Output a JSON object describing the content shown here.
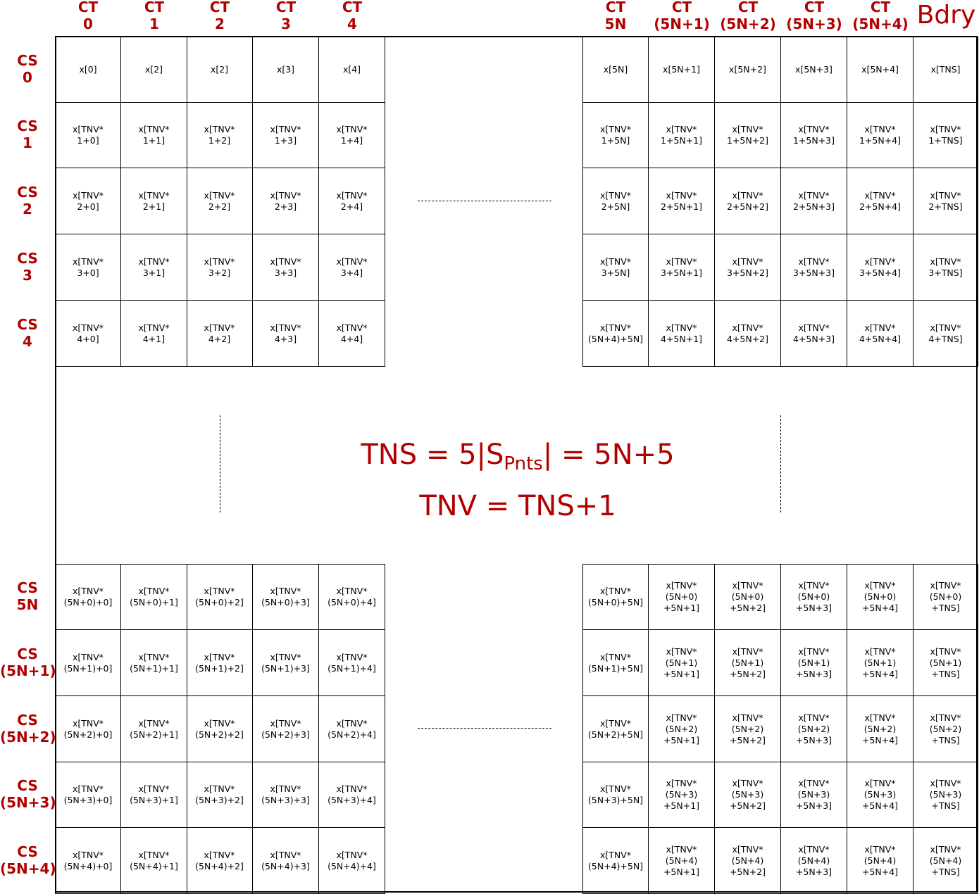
{
  "col_headers_left": [
    "CT\n0",
    "CT\n1",
    "CT\n2",
    "CT\n3",
    "CT\n4"
  ],
  "col_headers_right": [
    "CT\n5N",
    "CT\n(5N+1)",
    "CT\n(5N+2)",
    "CT\n(5N+3)",
    "CT\n(5N+4)"
  ],
  "bdry_label": "Bdry",
  "row_headers_top": [
    "CS\n0",
    "CS\n1",
    "CS\n2",
    "CS\n3",
    "CS\n4"
  ],
  "row_headers_bottom": [
    "CS\n5N",
    "CS\n(5N+1)",
    "CS\n(5N+2)",
    "CS\n(5N+3)",
    "CS\n(5N+4)"
  ],
  "blocks": {
    "top_left": [
      [
        "x[0]",
        "x[2]",
        "x[2]",
        "x[3]",
        "x[4]"
      ],
      [
        "x[TNV*\n1+0]",
        "x[TNV*\n1+1]",
        "x[TNV*\n1+2]",
        "x[TNV*\n1+3]",
        "x[TNV*\n1+4]"
      ],
      [
        "x[TNV*\n2+0]",
        "x[TNV*\n2+1]",
        "x[TNV*\n2+2]",
        "x[TNV*\n2+3]",
        "x[TNV*\n2+4]"
      ],
      [
        "x[TNV*\n3+0]",
        "x[TNV*\n3+1]",
        "x[TNV*\n3+2]",
        "x[TNV*\n3+3]",
        "x[TNV*\n3+4]"
      ],
      [
        "x[TNV*\n4+0]",
        "x[TNV*\n4+1]",
        "x[TNV*\n4+2]",
        "x[TNV*\n4+3]",
        "x[TNV*\n4+4]"
      ]
    ],
    "top_right": [
      [
        "x[5N]",
        "x[5N+1]",
        "x[5N+2]",
        "x[5N+3]",
        "x[5N+4]",
        "x[TNS]"
      ],
      [
        "x[TNV*\n1+5N]",
        "x[TNV*\n1+5N+1]",
        "x[TNV*\n1+5N+2]",
        "x[TNV*\n1+5N+3]",
        "x[TNV*\n1+5N+4]",
        "x[TNV*\n1+TNS]"
      ],
      [
        "x[TNV*\n2+5N]",
        "x[TNV*\n2+5N+1]",
        "x[TNV*\n2+5N+2]",
        "x[TNV*\n2+5N+3]",
        "x[TNV*\n2+5N+4]",
        "x[TNV*\n2+TNS]"
      ],
      [
        "x[TNV*\n3+5N]",
        "x[TNV*\n3+5N+1]",
        "x[TNV*\n3+5N+2]",
        "x[TNV*\n3+5N+3]",
        "x[TNV*\n3+5N+4]",
        "x[TNV*\n3+TNS]"
      ],
      [
        "x[TNV*\n(5N+4)+5N]",
        "x[TNV*\n4+5N+1]",
        "x[TNV*\n4+5N+2]",
        "x[TNV*\n4+5N+3]",
        "x[TNV*\n4+5N+4]",
        "x[TNV*\n4+TNS]"
      ]
    ],
    "bottom_left": [
      [
        "x[TNV*\n(5N+0)+0]",
        "x[TNV*\n(5N+0)+1]",
        "x[TNV*\n(5N+0)+2]",
        "x[TNV*\n(5N+0)+3]",
        "x[TNV*\n(5N+0)+4]"
      ],
      [
        "x[TNV*\n(5N+1)+0]",
        "x[TNV*\n(5N+1)+1]",
        "x[TNV*\n(5N+1)+2]",
        "x[TNV*\n(5N+1)+3]",
        "x[TNV*\n(5N+1)+4]"
      ],
      [
        "x[TNV*\n(5N+2)+0]",
        "x[TNV*\n(5N+2)+1]",
        "x[TNV*\n(5N+2)+2]",
        "x[TNV*\n(5N+2)+3]",
        "x[TNV*\n(5N+2)+4]"
      ],
      [
        "x[TNV*\n(5N+3)+0]",
        "x[TNV*\n(5N+3)+1]",
        "x[TNV*\n(5N+3)+2]",
        "x[TNV*\n(5N+3)+3]",
        "x[TNV*\n(5N+3)+4]"
      ],
      [
        "x[TNV*\n(5N+4)+0]",
        "x[TNV*\n(5N+4)+1]",
        "x[TNV*\n(5N+4)+2]",
        "x[TNV*\n(5N+4)+3]",
        "x[TNV*\n(5N+4)+4]"
      ]
    ],
    "bottom_right": [
      [
        "x[TNV*\n(5N+0)+5N]",
        "x[TNV*\n(5N+0)\n+5N+1]",
        "x[TNV*\n(5N+0)\n+5N+2]",
        "x[TNV*\n(5N+0)\n+5N+3]",
        "x[TNV*\n(5N+0)\n+5N+4]",
        "x[TNV*\n(5N+0)\n+TNS]"
      ],
      [
        "x[TNV*\n(5N+1)+5N]",
        "x[TNV*\n(5N+1)\n+5N+1]",
        "x[TNV*\n(5N+1)\n+5N+2]",
        "x[TNV*\n(5N+1)\n+5N+3]",
        "x[TNV*\n(5N+1)\n+5N+4]",
        "x[TNV*\n(5N+1)\n+TNS]"
      ],
      [
        "x[TNV*\n(5N+2)+5N]",
        "x[TNV*\n(5N+2)\n+5N+1]",
        "x[TNV*\n(5N+2)\n+5N+2]",
        "x[TNV*\n(5N+2)\n+5N+3]",
        "x[TNV*\n(5N+2)\n+5N+4]",
        "x[TNV*\n(5N+2)\n+TNS]"
      ],
      [
        "x[TNV*\n(5N+3)+5N]",
        "x[TNV*\n(5N+3)\n+5N+1]",
        "x[TNV*\n(5N+3)\n+5N+2]",
        "x[TNV*\n(5N+3)\n+5N+3]",
        "x[TNV*\n(5N+3)\n+5N+4]",
        "x[TNV*\n(5N+3)\n+TNS]"
      ],
      [
        "x[TNV*\n(5N+4)+5N]",
        "x[TNV*\n(5N+4)\n+5N+1]",
        "x[TNV*\n(5N+4)\n+5N+2]",
        "x[TNV*\n(5N+4)\n+5N+3]",
        "x[TNV*\n(5N+4)\n+5N+4]",
        "x[TNV*\n(5N+4)\n+TNS]"
      ]
    ]
  },
  "formula": {
    "tns_prefix": "TNS = 5|S",
    "tns_sub": "Pnts",
    "tns_suffix": "| = 5N+5",
    "tnv": "TNV = TNS+1"
  }
}
